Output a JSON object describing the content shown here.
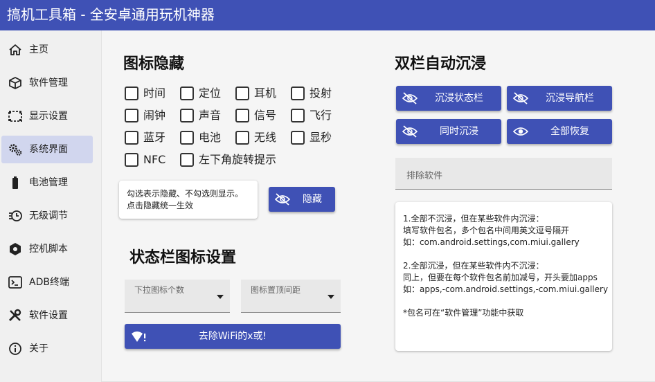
{
  "app": {
    "title": "搞机工具箱 - 全安卓通用玩机神器"
  },
  "sidebar": {
    "items": [
      {
        "label": "主页",
        "icon": "home-icon"
      },
      {
        "label": "软件管理",
        "icon": "package-icon"
      },
      {
        "label": "显示设置",
        "icon": "display-icon"
      },
      {
        "label": "系统界面",
        "icon": "gears-icon"
      },
      {
        "label": "电池管理",
        "icon": "battery-icon"
      },
      {
        "label": "无级调节",
        "icon": "timer-icon"
      },
      {
        "label": "控机脚本",
        "icon": "hexagon-icon"
      },
      {
        "label": "ADB终端",
        "icon": "terminal-icon"
      },
      {
        "label": "软件设置",
        "icon": "tools-icon"
      },
      {
        "label": "关于",
        "icon": "info-icon"
      }
    ],
    "active_index": 3
  },
  "icon_hide": {
    "title": "图标隐藏",
    "checkboxes": [
      "时间",
      "定位",
      "耳机",
      "投射",
      "闹钟",
      "声音",
      "信号",
      "飞行",
      "蓝牙",
      "电池",
      "无线",
      "显秒",
      "NFC",
      "左下角旋转提示"
    ],
    "hint": {
      "line1": "勾选表示隐藏、不勾选则显示。",
      "line2": "点击隐藏统一生效"
    },
    "hide_button": "隐藏"
  },
  "statusbar_icons": {
    "title": "状态栏图标设置",
    "dropdown_count": "下拉图标个数",
    "dropdown_spacing": "图标置顶间距",
    "wifi_button": "去除WiFi的x或!"
  },
  "immersive": {
    "title": "双栏自动沉浸",
    "buttons": {
      "status_bar": "沉浸状态栏",
      "nav_bar": "沉浸导航栏",
      "both": "同时沉浸",
      "restore": "全部恢复"
    },
    "exclude_placeholder": "排除软件",
    "info": {
      "l1": "1.全部不沉浸，但在某些软件内沉浸：",
      "l2": "填写软件包名，多个包名中间用英文逗号隔开",
      "l3": "如：com.android.settings,com.miui.gallery",
      "l4": "2.全部沉浸，但在某些软件内不沉浸：",
      "l5": "同上，但要在每个软件包名前加减号，开头要加apps",
      "l6": "如：apps,-com.android.settings,-com.miui.gallery",
      "l7": "*包名可在“软件管理”功能中获取"
    }
  },
  "colors": {
    "accent": "#3f51b5",
    "active_nav": "#d1d6ee"
  }
}
